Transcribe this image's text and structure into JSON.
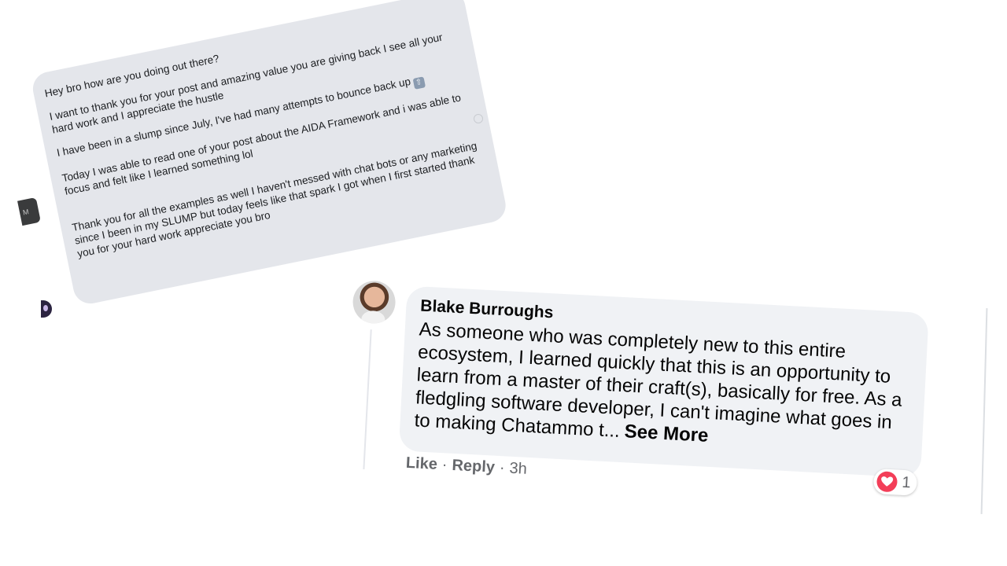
{
  "message": {
    "paragraphs": [
      "Hey bro how are you doing out there?",
      "I want to thank you for your post and amazing value you are giving back I see all your hard work and I appreciate the hustle",
      "I have been in a slump since July, I've had many attempts to bounce back up",
      "Today I was able to read one of your post about the AIDA Framework and i was able to focus and felt like I learned something lol",
      "Thank you for all the examples as well I haven't messed with chat bots or any marketing since I been in my SLUMP but today feels like that spark I got when I first started thank you for your hard work appreciate you bro"
    ],
    "emoji_label": "up-arrow-emoji",
    "side_tab_text": "М"
  },
  "comment": {
    "author": "Blake Burroughs",
    "text": "As someone who was completely new to this entire ecosystem, I learned quickly that this is an opportunity to learn from a master of their craft(s), basically for free. As a fledgling software developer, I can't imagine what goes in to making Chatammo t...",
    "see_more": "See More",
    "actions": {
      "like": "Like",
      "reply": "Reply",
      "time": "3h"
    },
    "reactions": {
      "type": "love",
      "count": "1"
    }
  },
  "colors": {
    "message_bubble": "#e4e6eb",
    "comment_bubble": "#f0f2f5",
    "heart": "#f33e58",
    "secondary_text": "#65676b"
  }
}
